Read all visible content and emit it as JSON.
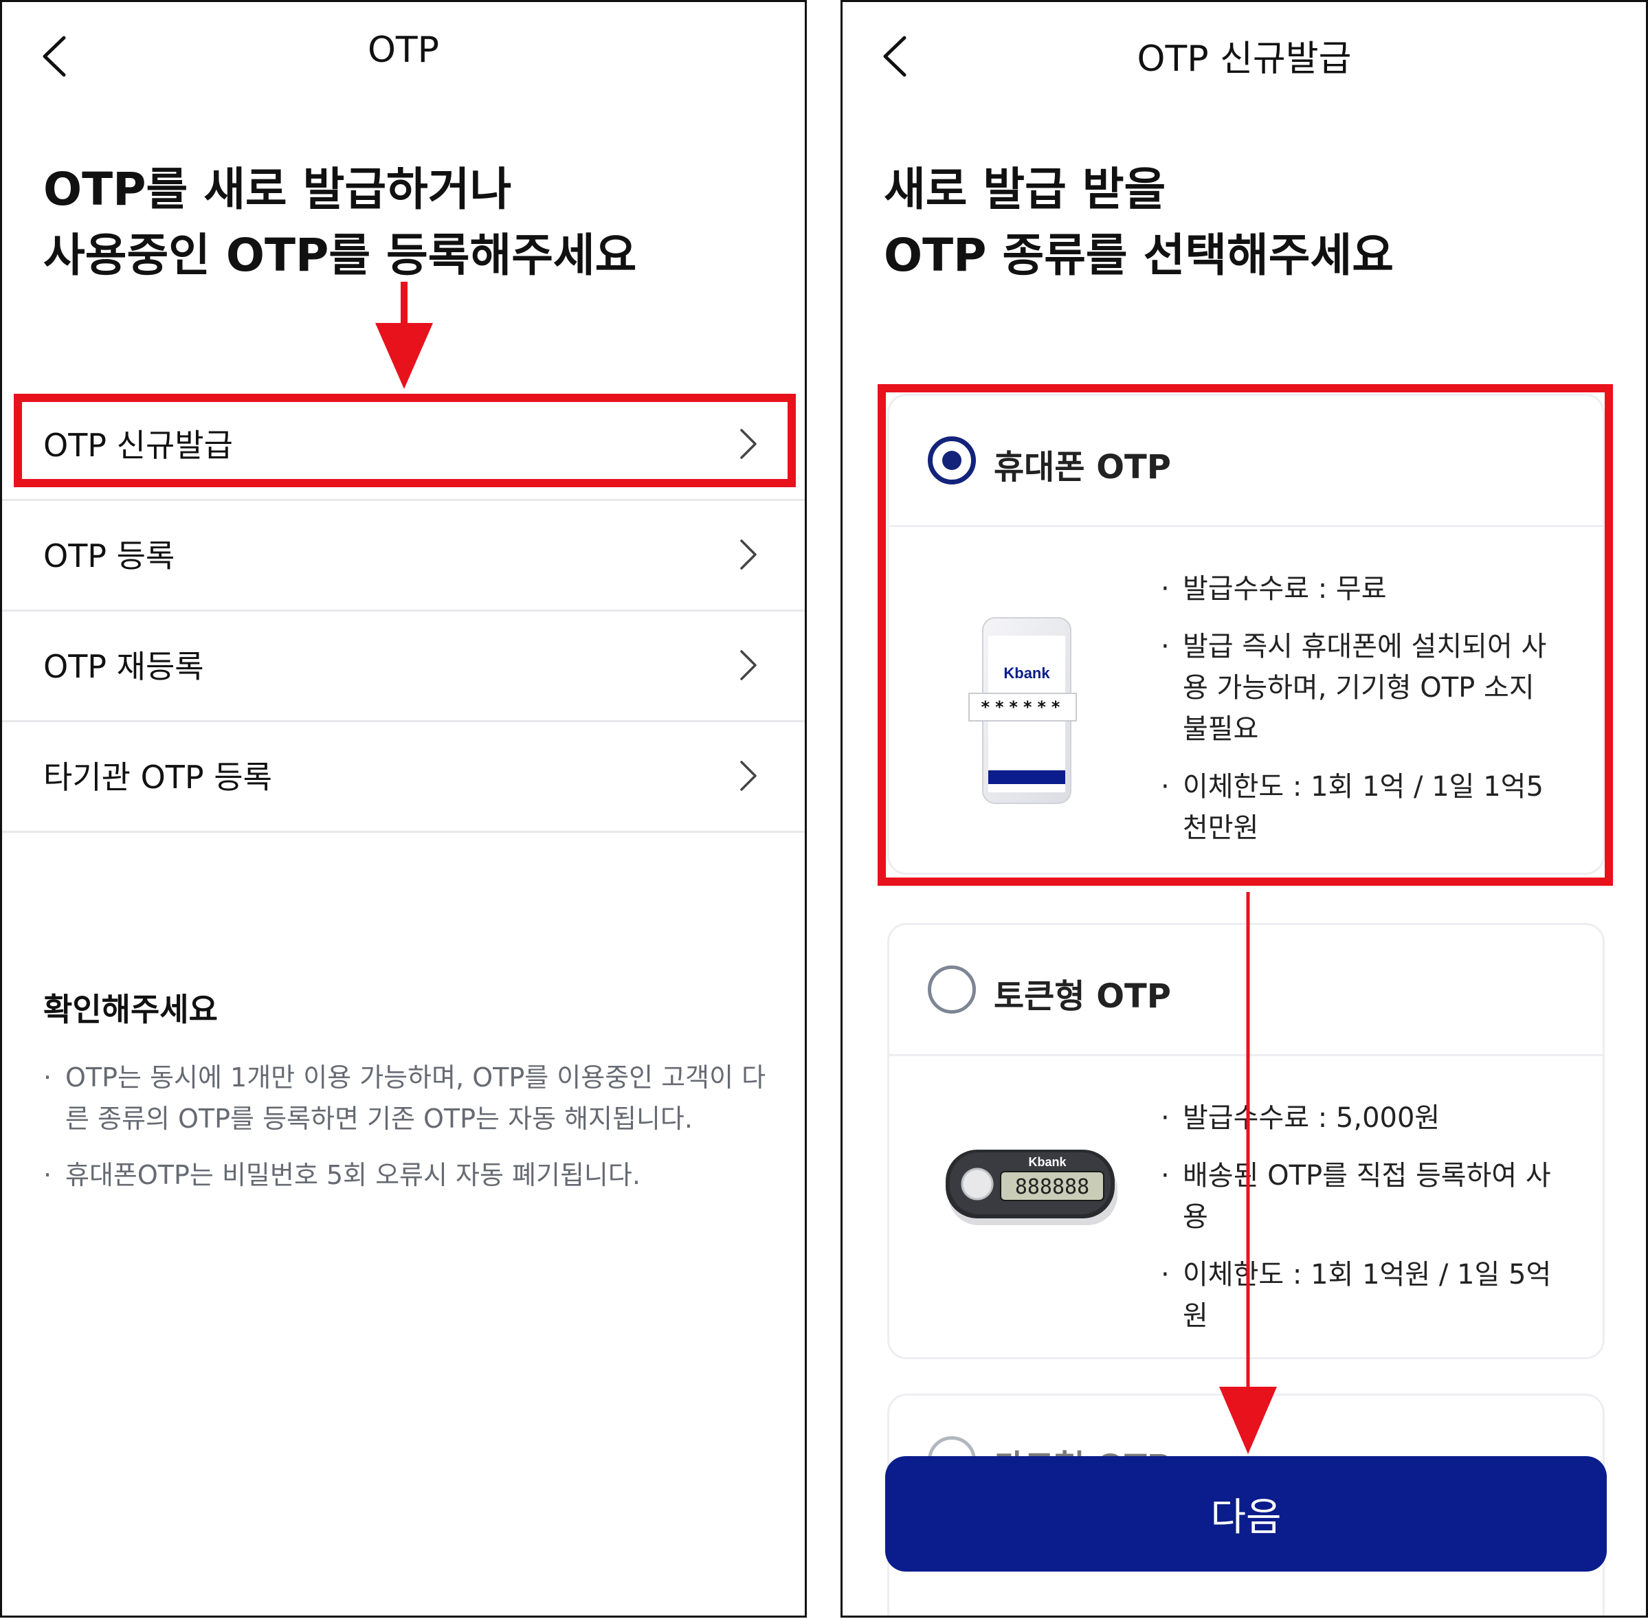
{
  "left_screen": {
    "header_title": "OTP",
    "heading_lines": [
      "OTP를 새로 발급하거나",
      "사용중인 OTP를 등록해주세요"
    ],
    "menu_items": [
      {
        "label": "OTP 신규발급"
      },
      {
        "label": "OTP 등록"
      },
      {
        "label": "OTP 재등록"
      },
      {
        "label": "타기관 OTP 등록"
      }
    ],
    "notice": {
      "title": "확인해주세요",
      "items": [
        "OTP는 동시에 1개만 이용 가능하며, OTP를 이용중인 고객이 다른 종류의 OTP를 등록하면 기존 OTP는 자동 해지됩니다.",
        "휴대폰OTP는 비밀번호 5회 오류시 자동 폐기됩니다."
      ]
    }
  },
  "right_screen": {
    "header_title": "OTP 신규발급",
    "heading_lines": [
      "새로 발급 받을",
      "OTP 종류를 선택해주세요"
    ],
    "options": [
      {
        "title": "휴대폰 OTP",
        "selected": true,
        "image_brand": "Kbank",
        "image_code": "******",
        "details": [
          "발급수수료 : 무료",
          "발급 즉시 휴대폰에 설치되어 사용 가능하며, 기기형 OTP 소지 불필요",
          "이체한도 : 1회 1억 / 1일 1억5천만원"
        ]
      },
      {
        "title": "토큰형 OTP",
        "selected": false,
        "image_brand": "Kbank",
        "image_code": "888888",
        "details": [
          "발급수수료 : 5,000원",
          "배송된 OTP를 직접 등록하여 사용",
          "이체한도 : 1회 1억원 / 1일 5억원"
        ]
      },
      {
        "title": "카드형 OTP",
        "selected": false
      }
    ],
    "next_button": "다음"
  },
  "colors": {
    "annotation_red": "#e8121d",
    "brand_navy": "#0b1d8c",
    "radio_navy": "#14237a",
    "divider": "#e8e8ec"
  },
  "icons": [
    "back-chevron-icon",
    "chevron-right-icon",
    "radio-selected-icon",
    "radio-unselected-icon",
    "phone-otp-image",
    "token-otp-image"
  ]
}
